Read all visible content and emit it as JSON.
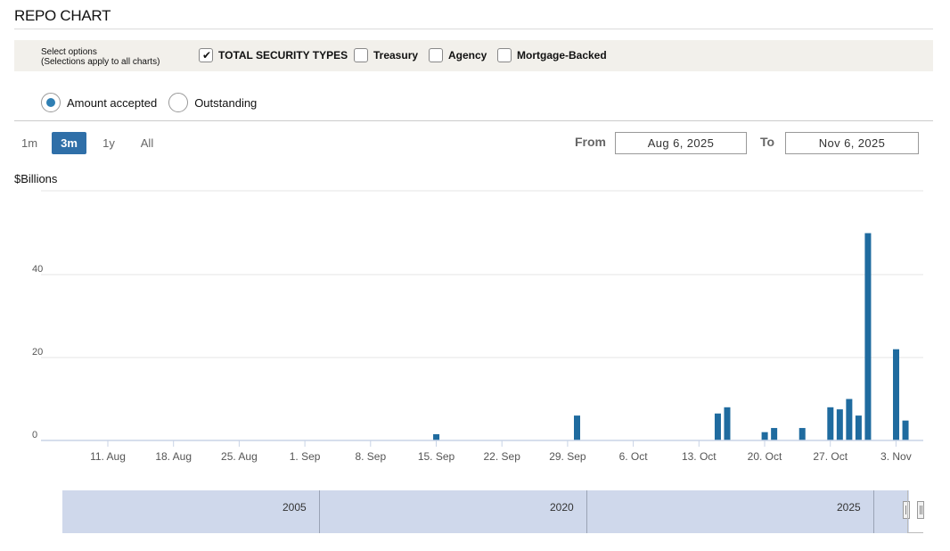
{
  "header": {
    "title": "REPO CHART"
  },
  "options": {
    "hint_line1": "Select options",
    "hint_line2": "(Selections apply to all charts)",
    "checkboxes": [
      {
        "label": "TOTAL SECURITY TYPES",
        "checked": true
      },
      {
        "label": "Treasury",
        "checked": false
      },
      {
        "label": "Agency",
        "checked": false
      },
      {
        "label": "Mortgage-Backed",
        "checked": false
      }
    ]
  },
  "radios": [
    {
      "label": "Amount accepted",
      "selected": true
    },
    {
      "label": "Outstanding",
      "selected": false
    }
  ],
  "range_selector": {
    "buttons": [
      "1m",
      "3m",
      "1y",
      "All"
    ],
    "active": "3m"
  },
  "date_range": {
    "from_label": "From",
    "from_value": "Aug 6, 2025",
    "to_label": "To",
    "to_value": "Nov 6, 2025"
  },
  "navigator": {
    "labels": [
      "2005",
      "2020",
      "2025"
    ]
  },
  "colors": {
    "bar": "#1f6b9f",
    "accent": "#2f6fa8",
    "options_bg": "#f2f0eb",
    "navigator_bg": "#cfd8eb"
  },
  "chart_data": {
    "type": "bar",
    "ylabel": "$Billions",
    "yticks": [
      0,
      20,
      40
    ],
    "x_ticks": [
      "11. Aug",
      "18. Aug",
      "25. Aug",
      "1. Sep",
      "8. Sep",
      "15. Sep",
      "22. Sep",
      "29. Sep",
      "6. Oct",
      "13. Oct",
      "20. Oct",
      "27. Oct",
      "3. Nov"
    ],
    "x_range": [
      "2025-08-06",
      "2025-11-06"
    ],
    "ylim": [
      0,
      60
    ],
    "grid": true,
    "series": [
      {
        "points": [
          {
            "date": "2025-09-15",
            "value": 1.5
          },
          {
            "date": "2025-09-30",
            "value": 6.0
          },
          {
            "date": "2025-10-15",
            "value": 6.5
          },
          {
            "date": "2025-10-16",
            "value": 8.0
          },
          {
            "date": "2025-10-20",
            "value": 2.0
          },
          {
            "date": "2025-10-21",
            "value": 3.0
          },
          {
            "date": "2025-10-24",
            "value": 3.0
          },
          {
            "date": "2025-10-27",
            "value": 8.0
          },
          {
            "date": "2025-10-28",
            "value": 7.5
          },
          {
            "date": "2025-10-29",
            "value": 10.0
          },
          {
            "date": "2025-10-30",
            "value": 6.0
          },
          {
            "date": "2025-10-31",
            "value": 50.0
          },
          {
            "date": "2025-11-03",
            "value": 22.0
          },
          {
            "date": "2025-11-04",
            "value": 4.8
          }
        ]
      }
    ]
  }
}
